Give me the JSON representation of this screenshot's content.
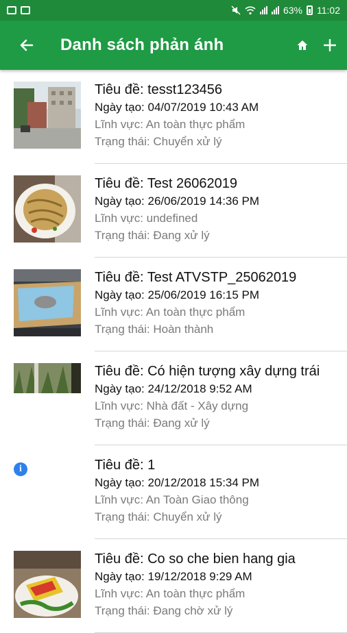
{
  "status_bar": {
    "battery": "63%",
    "time": "11:02"
  },
  "header": {
    "title": "Danh sách phản ánh",
    "back_icon": "arrow-left-icon",
    "home_icon": "home-icon",
    "add_icon": "plus-icon"
  },
  "colors": {
    "status_bar": "#1f8a3a",
    "app_bar": "#1f9a45",
    "info_icon": "#2f80ed"
  },
  "reports": [
    {
      "title": "Tiêu đề: tesst123456",
      "date": "Ngày tạo: 04/07/2019 10:43 AM",
      "field": "Lĩnh vực: An toàn thực phẩm",
      "status": "Trạng thái: Chuyển xử lý",
      "thumb": "street-photo"
    },
    {
      "title": "Tiêu đề: Test 26062019",
      "date": "Ngày tạo: 26/06/2019 14:36 PM",
      "field": "Lĩnh vực: undefined",
      "status": "Trạng thái: Đang xử lý",
      "thumb": "noodle-photo"
    },
    {
      "title": "Tiêu đề: Test ATVSTP_25062019",
      "date": "Ngày tạo: 25/06/2019 16:15 PM",
      "field": "Lĩnh vực: An toàn thực phẩm",
      "status": "Trạng thái: Hoàn thành",
      "thumb": "desk-photo"
    },
    {
      "title": "Tiêu đề: Có hiện tượng xây dựng trái",
      "date": "Ngày tạo: 24/12/2018 9:52 AM",
      "field": "Lĩnh vực: Nhà đất - Xây dựng",
      "status": "Trạng thái: Đang xử lý",
      "thumb": "trees-photo"
    },
    {
      "title": "Tiêu đề: 1",
      "date": "Ngày tạo: 20/12/2018 15:34 PM",
      "field": "Lĩnh vực: An Toàn Giao thông",
      "status": "Trạng thái: Chuyển xử lý",
      "thumb": "info-icon"
    },
    {
      "title": "Tiêu đề: Co so che bien hang gia",
      "date": "Ngày tạo: 19/12/2018 9:29 AM",
      "field": "Lĩnh vực: An toàn thực phẩm",
      "status": "Trạng thái: Đang chờ xử lý",
      "thumb": "food-package-photo"
    }
  ]
}
